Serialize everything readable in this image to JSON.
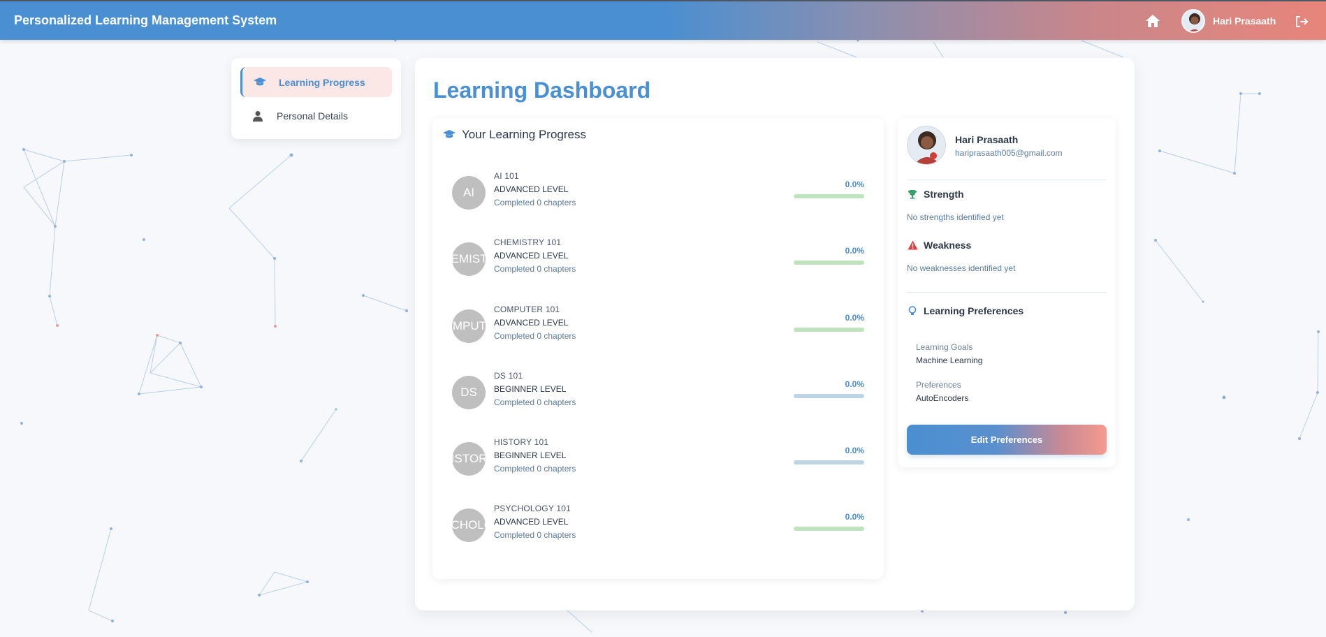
{
  "app": {
    "title": "Personalized Learning Management System"
  },
  "nav": {
    "user_name": "Hari Prasaath",
    "home_icon": "home-icon",
    "logout_icon": "logout-icon"
  },
  "sidebar": {
    "items": [
      {
        "label": "Learning Progress",
        "icon": "graduation-cap-icon",
        "active": true
      },
      {
        "label": "Personal Details",
        "icon": "user-icon",
        "active": false
      }
    ]
  },
  "main": {
    "title": "Learning Dashboard",
    "progress": {
      "heading": "Your Learning Progress",
      "courses": [
        {
          "initials": "AI",
          "name": "AI 101",
          "level": "ADVANCED LEVEL",
          "completed": "Completed 0 chapters",
          "percent": "0.0%",
          "fraction": 0
        },
        {
          "initials": "CHEMISTRY",
          "name": "CHEMISTRY 101",
          "level": "ADVANCED LEVEL",
          "completed": "Completed 0 chapters",
          "percent": "0.0%",
          "fraction": 0
        },
        {
          "initials": "COMPUTER",
          "name": "COMPUTER 101",
          "level": "ADVANCED LEVEL",
          "completed": "Completed 0 chapters",
          "percent": "0.0%",
          "fraction": 0
        },
        {
          "initials": "DS",
          "name": "DS 101",
          "level": "BEGINNER LEVEL",
          "completed": "Completed 0 chapters",
          "percent": "0.0%",
          "fraction": 0
        },
        {
          "initials": "HISTORY",
          "name": "HISTORY 101",
          "level": "BEGINNER LEVEL",
          "completed": "Completed 0 chapters",
          "percent": "0.0%",
          "fraction": 0
        },
        {
          "initials": "PSYCHOLOGY",
          "name": "PSYCHOLOGY 101",
          "level": "ADVANCED LEVEL",
          "completed": "Completed 0 chapters",
          "percent": "0.0%",
          "fraction": 0
        }
      ]
    }
  },
  "profile": {
    "name": "Hari Prasaath",
    "email": "hariprasaath005@gmail.com",
    "strength": {
      "label": "Strength",
      "text": "No strengths identified yet"
    },
    "weakness": {
      "label": "Weakness",
      "text": "No weaknesses identified yet"
    },
    "preferences": {
      "label": "Learning Preferences",
      "goals_label": "Learning Goals",
      "goals_value": "Machine Learning",
      "prefs_label": "Preferences",
      "prefs_value": "AutoEncoders"
    },
    "edit_button": "Edit Preferences"
  },
  "colors": {
    "accent": "#4a8fd1",
    "accent_warm": "#f59a8f",
    "advanced_bar": "#bfe3bf",
    "beginner_bar": "#bcd4e6",
    "strength_icon": "#38a169",
    "weakness_icon": "#e53e3e"
  }
}
